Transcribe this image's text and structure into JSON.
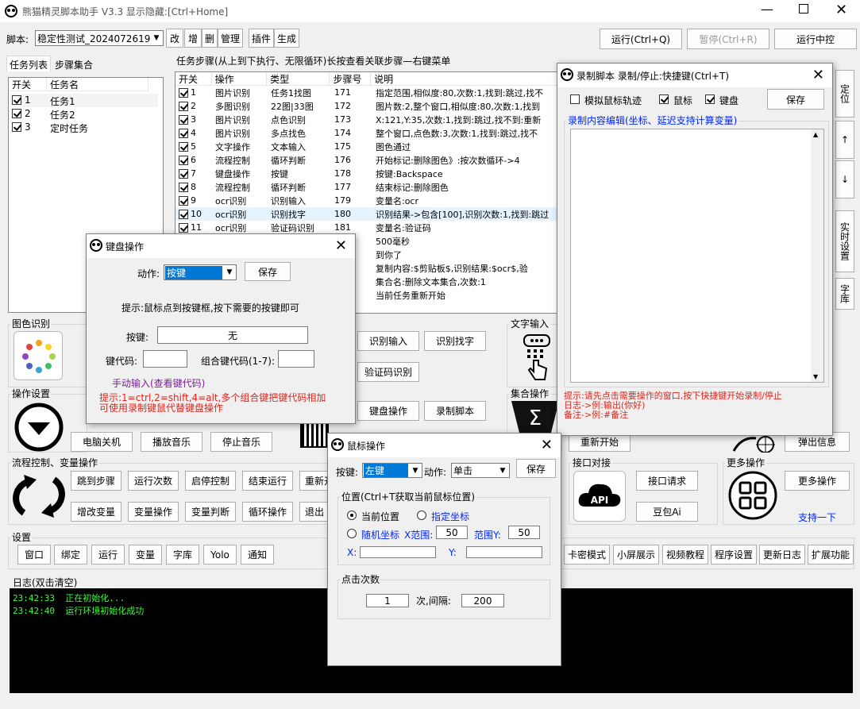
{
  "window": {
    "title": "熊猫精灵脚本助手  V3.3   显示隐藏:[Ctrl+Home]"
  },
  "toolbar": {
    "script_label": "脚本:",
    "script_select": "稳定性测试_2024072619191",
    "buttons": [
      "改",
      "增",
      "删",
      "管理",
      "插件",
      "生成"
    ],
    "run": "运行(Ctrl+Q)",
    "pause": "暂停(Ctrl+R)",
    "run_center": "运行中控"
  },
  "left_tabs": [
    "任务列表",
    "步骤集合"
  ],
  "task_list": {
    "headers": [
      "开关",
      "任务名"
    ],
    "rows": [
      {
        "id": "1",
        "name": "任务1"
      },
      {
        "id": "2",
        "name": "任务2"
      },
      {
        "id": "3",
        "name": "定时任务"
      }
    ]
  },
  "steps": {
    "title": "任务步骤(从上到下执行、无限循环)长按查看关联步骤—右键菜单",
    "headers": [
      "开关",
      "操作",
      "类型",
      "步骤号",
      "说明"
    ],
    "rows": [
      {
        "id": "1",
        "op": "图片识别",
        "type": "任务1找图",
        "num": "171",
        "desc": "指定范围,相似度:80,次数:1,找到:跳过,找不"
      },
      {
        "id": "2",
        "op": "多图识别",
        "type": "22图|33图",
        "num": "172",
        "desc": "图片数:2,整个窗口,相似度:80,次数:1,找到"
      },
      {
        "id": "3",
        "op": "图片识别",
        "type": "点色识别",
        "num": "173",
        "desc": "X:121,Y:35,次数:1,找到:跳过,找不到:重新"
      },
      {
        "id": "4",
        "op": "图片识别",
        "type": "多点找色",
        "num": "174",
        "desc": "整个窗口,点色数:3,次数:1,找到:跳过,找不"
      },
      {
        "id": "5",
        "op": "文字操作",
        "type": "文本输入",
        "num": "175",
        "desc": "图色通过"
      },
      {
        "id": "6",
        "op": "流程控制",
        "type": "循环判断",
        "num": "176",
        "desc": "开始标记:删除图色》:按次数循环->4"
      },
      {
        "id": "7",
        "op": "键盘操作",
        "type": "按键",
        "num": "178",
        "desc": "按键:Backspace"
      },
      {
        "id": "8",
        "op": "流程控制",
        "type": "循环判断",
        "num": "177",
        "desc": "结束标记:删除图色"
      },
      {
        "id": "9",
        "op": "ocr识别",
        "type": "识别输入",
        "num": "179",
        "desc": "变量名:ocr"
      },
      {
        "id": "10",
        "op": "ocr识别",
        "type": "识别找字",
        "num": "180",
        "desc": "识别结果->包含[100],识别次数:1,找到:跳过"
      },
      {
        "id": "11",
        "op": "ocr识别",
        "type": "验证码识别",
        "num": "181",
        "desc": "变量名:验证码"
      },
      {
        "id": "",
        "op": "",
        "type": "",
        "num": "",
        "desc": "500毫秒"
      },
      {
        "id": "",
        "op": "",
        "type": "",
        "num": "",
        "desc": "到你了"
      },
      {
        "id": "",
        "op": "",
        "type": "",
        "num": "",
        "desc": "复制内容:$剪贴板$,识别结果:$ocr$,验"
      },
      {
        "id": "",
        "op": "",
        "type": "",
        "num": "",
        "desc": "集合名:删除文本集合,次数:1"
      },
      {
        "id": "",
        "op": "",
        "type": "",
        "num": "",
        "desc": "当前任务重新开始"
      }
    ]
  },
  "right_side": {
    "locate": "定位",
    "up": "↑",
    "down": "↓",
    "realtime": "实时设置",
    "lib": "字库"
  },
  "sections": {
    "color": "图色识别",
    "text_op": "文字输入",
    "ops": "操作设置",
    "collection": "集合操作",
    "flow": "流程控制、变量操作",
    "api": "接口对接",
    "more": "更多操作",
    "settings": "设置",
    "log": "日志(双击清空)"
  },
  "buttons": {
    "ocr_input": "识别输入",
    "ocr_find": "识别找字",
    "captcha": "验证码识别",
    "keyboard_op": "键盘操作",
    "record_script": "录制脚本",
    "shutdown": "电脑关机",
    "play_music": "播放音乐",
    "stop_music": "停止音乐",
    "restart": "重新开始",
    "popup": "弹出信息",
    "jump": "跳到步骤",
    "run_times": "运行次数",
    "start_stop": "启停控制",
    "end_run": "结束运行",
    "restart2": "重新开",
    "add_var": "增改变量",
    "var_op": "变量操作",
    "var_judge": "变量判断",
    "loop_op": "循环操作",
    "exit": "退出",
    "api_req": "接口请求",
    "doubao": "豆包Ai",
    "more_op": "更多操作",
    "support": "支持一下",
    "settings_row": [
      "窗口",
      "绑定",
      "运行",
      "变量",
      "字库",
      "Yolo",
      "通知"
    ],
    "right_row": [
      "卡密模式",
      "小屏展示",
      "视频教程",
      "程序设置",
      "更新日志",
      "扩展功能"
    ]
  },
  "log": {
    "lines": [
      {
        "time": "23:42:33",
        "msg": "正在初始化..."
      },
      {
        "time": "23:42:40",
        "msg": "运行环境初始化成功"
      }
    ]
  },
  "keyboard_dialog": {
    "title": "键盘操作",
    "action_label": "动作:",
    "action_value": "按键",
    "save": "保存",
    "hint": "提示:鼠标点到按键框,按下需要的按键即可",
    "key_label": "按键:",
    "key_value": "无",
    "keycode_label": "键代码:",
    "combo_label": "组合键代码(1-7):",
    "manual": "手动输入(查看键代码)",
    "tip1": "提示:1=ctrl,2=shift,4=alt,多个组合键把键代码相加",
    "tip2": "可使用录制键鼠代替键盘操作"
  },
  "record_dialog": {
    "title": "录制脚本  录制/停止:快捷键(Ctrl+T)",
    "sim_mouse": "模拟鼠标轨迹",
    "mouse": "鼠标",
    "keyboard": "键盘",
    "save": "保存",
    "edit_title": "录制内容编辑(坐标、延迟支持计算变量)",
    "tip1": "提示:请先点击需要操作的窗口,按下快捷键开始录制/停止",
    "tip2": "日志->例:输出(你好)",
    "tip3": "备注->例:#备注"
  },
  "mouse_dialog": {
    "title": "鼠标操作",
    "key_label": "按键:",
    "key_value": "左键",
    "action_label": "动作:",
    "action_value": "单击",
    "save": "保存",
    "pos_title": "位置(Ctrl+T获取当前鼠标位置)",
    "current": "当前位置",
    "specified": "指定坐标",
    "random": "随机坐标",
    "xrange_label": "X范围:",
    "xrange": "50",
    "yrange_label": "范围Y:",
    "yrange": "50",
    "x_label": "X:",
    "y_label": "Y:",
    "clicks_title": "点击次数",
    "clicks": "1",
    "interval_label": "次,间隔:",
    "interval": "200"
  }
}
